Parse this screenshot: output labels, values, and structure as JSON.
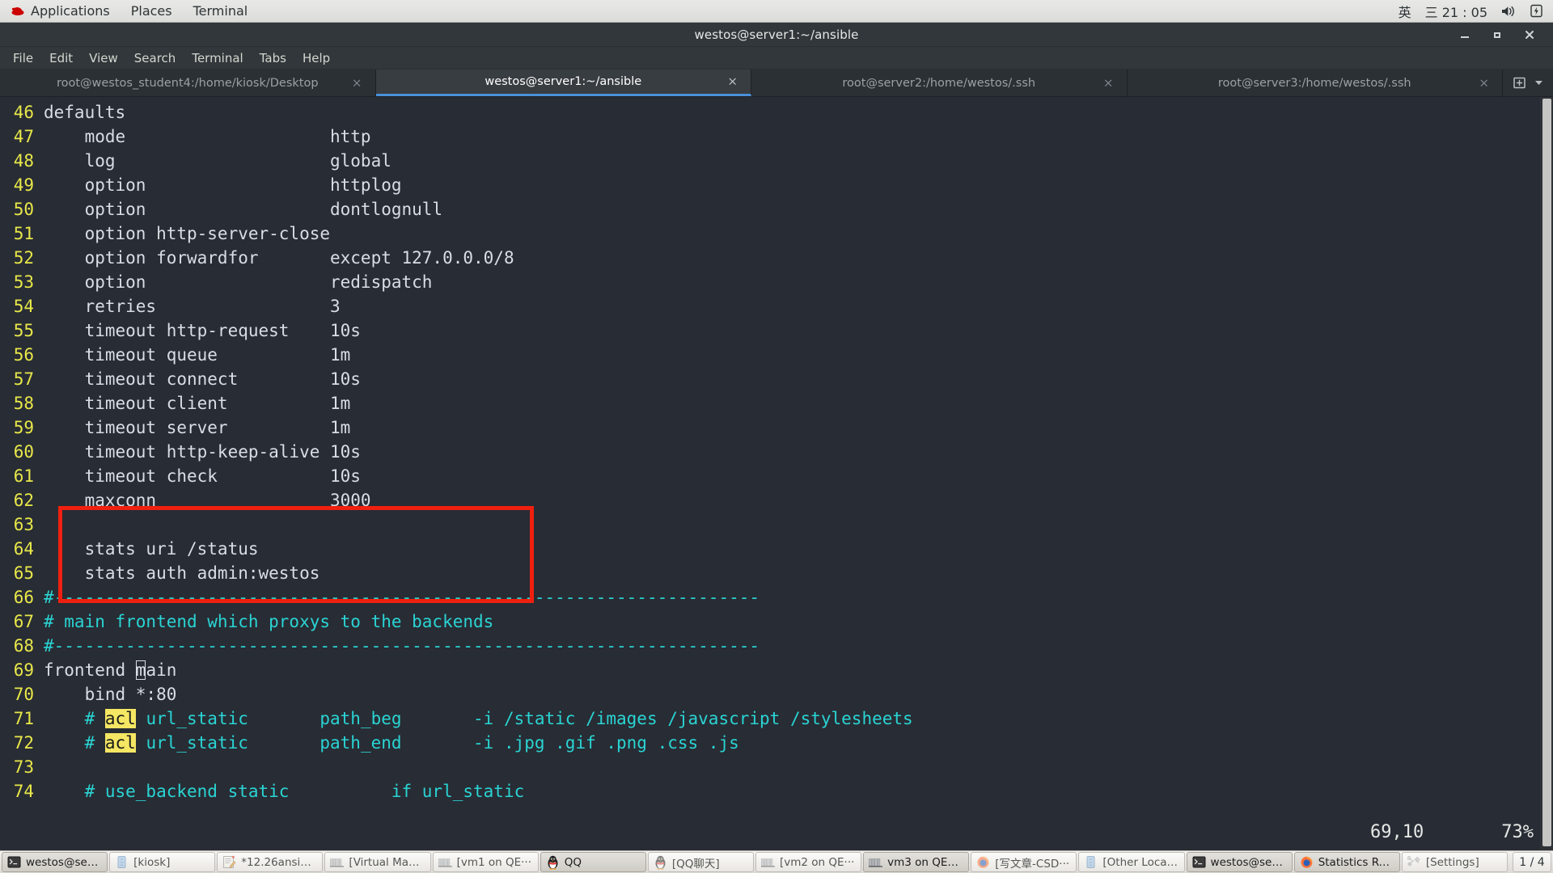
{
  "desktop": {
    "panel": {
      "logo_icon": "redhat-logo-icon",
      "menus": [
        "Applications",
        "Places",
        "Terminal"
      ],
      "tray": {
        "input_method": "英",
        "clock": "三 21 : 05",
        "volume_icon": "volume-icon",
        "battery_icon": "battery-charging-icon"
      }
    }
  },
  "window": {
    "title": "westos@server1:~/ansible",
    "controls": {
      "minimize": "minimize-icon",
      "maximize": "maximize-icon",
      "close": "close-icon"
    },
    "menubar": [
      "File",
      "Edit",
      "View",
      "Search",
      "Terminal",
      "Tabs",
      "Help"
    ],
    "tabs": [
      {
        "label": "root@westos_student4:/home/kiosk/Desktop",
        "active": false,
        "close": "×"
      },
      {
        "label": "westos@server1:~/ansible",
        "active": true,
        "close": "×"
      },
      {
        "label": "root@server2:/home/westos/.ssh",
        "active": false,
        "close": "×"
      },
      {
        "label": "root@server3:/home/westos/.ssh",
        "active": false,
        "close": "×"
      }
    ],
    "tab_extra": {
      "new_tab_icon": "new-tab-icon",
      "chevron_icon": "chevron-down-icon"
    }
  },
  "editor": {
    "type": "vim",
    "status_position": "69,10",
    "status_percent": "73%",
    "annotation": {
      "color": "#f02010",
      "shape": "rectangle",
      "covers_lines": "62-66"
    },
    "highlight_color": "#f5e663",
    "comment_color": "#2ad4d4",
    "linenum_color": "#e8e84a",
    "text_color": "#d8dee4",
    "background": "#282c34",
    "lines": [
      {
        "n": "46",
        "segs": [
          {
            "t": "defaults",
            "c": "txt"
          }
        ]
      },
      {
        "n": "47",
        "segs": [
          {
            "t": "    mode                    http",
            "c": "txt"
          }
        ]
      },
      {
        "n": "48",
        "segs": [
          {
            "t": "    log                     global",
            "c": "txt"
          }
        ]
      },
      {
        "n": "49",
        "segs": [
          {
            "t": "    option                  httplog",
            "c": "txt"
          }
        ]
      },
      {
        "n": "50",
        "segs": [
          {
            "t": "    option                  dontlognull",
            "c": "txt"
          }
        ]
      },
      {
        "n": "51",
        "segs": [
          {
            "t": "    option http-server-close",
            "c": "txt"
          }
        ]
      },
      {
        "n": "52",
        "segs": [
          {
            "t": "    option forwardfor       except 127.0.0.0/8",
            "c": "txt"
          }
        ]
      },
      {
        "n": "53",
        "segs": [
          {
            "t": "    option                  redispatch",
            "c": "txt"
          }
        ]
      },
      {
        "n": "54",
        "segs": [
          {
            "t": "    retries                 3",
            "c": "txt"
          }
        ]
      },
      {
        "n": "55",
        "segs": [
          {
            "t": "    timeout http-request    10s",
            "c": "txt"
          }
        ]
      },
      {
        "n": "56",
        "segs": [
          {
            "t": "    timeout queue           1m",
            "c": "txt"
          }
        ]
      },
      {
        "n": "57",
        "segs": [
          {
            "t": "    timeout connect         10s",
            "c": "txt"
          }
        ]
      },
      {
        "n": "58",
        "segs": [
          {
            "t": "    timeout client          1m",
            "c": "txt"
          }
        ]
      },
      {
        "n": "59",
        "segs": [
          {
            "t": "    timeout server          1m",
            "c": "txt"
          }
        ]
      },
      {
        "n": "60",
        "segs": [
          {
            "t": "    timeout http-keep-alive 10s",
            "c": "txt"
          }
        ]
      },
      {
        "n": "61",
        "segs": [
          {
            "t": "    timeout check           10s",
            "c": "txt"
          }
        ]
      },
      {
        "n": "62",
        "segs": [
          {
            "t": "    maxconn                 3000",
            "c": "txt"
          }
        ]
      },
      {
        "n": "63",
        "segs": [
          {
            "t": "",
            "c": "txt"
          }
        ]
      },
      {
        "n": "64",
        "segs": [
          {
            "t": "    stats uri /status",
            "c": "txt"
          }
        ]
      },
      {
        "n": "65",
        "segs": [
          {
            "t": "    stats auth admin:westos",
            "c": "txt"
          }
        ]
      },
      {
        "n": "66",
        "segs": [
          {
            "t": "#---------------------------------------------------------------------",
            "c": "cy"
          }
        ]
      },
      {
        "n": "67",
        "segs": [
          {
            "t": "# main frontend which proxys to the backends",
            "c": "cy"
          }
        ]
      },
      {
        "n": "68",
        "segs": [
          {
            "t": "#---------------------------------------------------------------------",
            "c": "cy"
          }
        ]
      },
      {
        "n": "69",
        "segs": [
          {
            "t": "frontend ",
            "c": "txt"
          },
          {
            "t": "m",
            "c": "cursor"
          },
          {
            "t": "ain",
            "c": "txt"
          }
        ]
      },
      {
        "n": "70",
        "segs": [
          {
            "t": "    bind *:80",
            "c": "txt"
          }
        ]
      },
      {
        "n": "71",
        "segs": [
          {
            "t": "    # ",
            "c": "cy"
          },
          {
            "t": "acl",
            "c": "hl"
          },
          {
            "t": " url_static       path_beg       -i /static /images /javascript /stylesheets",
            "c": "cy"
          }
        ]
      },
      {
        "n": "72",
        "segs": [
          {
            "t": "    # ",
            "c": "cy"
          },
          {
            "t": "acl",
            "c": "hl"
          },
          {
            "t": " url_static       path_end       -i .jpg .gif .png .css .js",
            "c": "cy"
          }
        ]
      },
      {
        "n": "73",
        "segs": [
          {
            "t": "",
            "c": "txt"
          }
        ]
      },
      {
        "n": "74",
        "segs": [
          {
            "t": "    # use_backend static          if url_static",
            "c": "cy"
          }
        ]
      }
    ]
  },
  "taskbar": {
    "items": [
      {
        "label": "westos@ser···",
        "icon": "terminal-icon",
        "active": true
      },
      {
        "label": "[kiosk]",
        "icon": "files-icon",
        "active": false
      },
      {
        "label": "*12.26ansibl···",
        "icon": "text-editor-icon",
        "active": false
      },
      {
        "label": "[Virtual Mach···",
        "icon": "virt-manager-icon",
        "active": false
      },
      {
        "label": "[vm1 on QE···",
        "icon": "virt-manager-icon",
        "active": false
      },
      {
        "label": "QQ",
        "icon": "qq-penguin-icon",
        "active": true
      },
      {
        "label": "[QQ聊天]",
        "icon": "qq-penguin-icon",
        "active": false
      },
      {
        "label": "[vm2 on QE···",
        "icon": "virt-manager-icon",
        "active": false
      },
      {
        "label": "vm3 on QEM···",
        "icon": "virt-manager-icon",
        "active": true
      },
      {
        "label": "[写文章-CSD···",
        "icon": "firefox-icon",
        "active": false
      },
      {
        "label": "[Other Locat···",
        "icon": "files-icon",
        "active": false
      },
      {
        "label": "westos@ser···",
        "icon": "terminal-icon",
        "active": true
      },
      {
        "label": "Statistics Re···",
        "icon": "firefox-icon",
        "active": true
      },
      {
        "label": "[Settings]",
        "icon": "settings-icon",
        "active": false
      }
    ],
    "workspace": "1 / 4"
  }
}
